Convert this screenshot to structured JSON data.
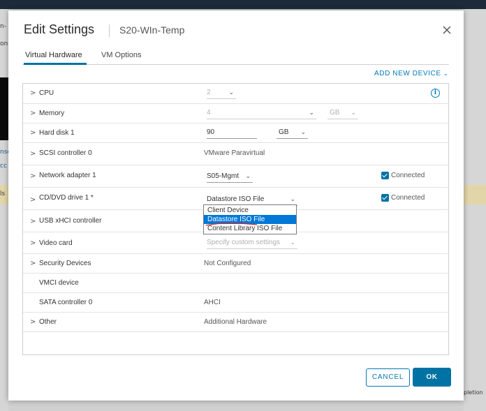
{
  "background": {
    "left_fragments": [
      "n-",
      "on",
      "nse",
      "cc",
      "ls"
    ],
    "right_fragment": "pletion"
  },
  "dialog": {
    "title": "Edit Settings",
    "subtitle": "S20-WIn-Temp",
    "close_icon": "close-icon"
  },
  "tabs": [
    {
      "label": "Virtual Hardware",
      "active": true
    },
    {
      "label": "VM Options",
      "active": false
    }
  ],
  "add_new_device": "ADD NEW DEVICE",
  "hardware": {
    "cpu": {
      "label": "CPU",
      "value": "2"
    },
    "memory": {
      "label": "Memory",
      "value": "4",
      "unit": "GB"
    },
    "hard_disk": {
      "label": "Hard disk 1",
      "value": "90",
      "unit": "GB"
    },
    "scsi": {
      "label": "SCSI controller 0",
      "value": "VMware Paravirtual"
    },
    "network": {
      "label": "Network adapter 1",
      "value": "S05-Mgmt",
      "connected_label": "Connected",
      "connected": true
    },
    "cdrom": {
      "label": "CD/DVD drive 1 *",
      "value": "Datastore ISO File",
      "connected_label": "Connected",
      "connected": true
    },
    "usb": {
      "label": "USB xHCI controller"
    },
    "video": {
      "label": "Video card",
      "value": "Specify custom settings"
    },
    "security": {
      "label": "Security Devices",
      "value": "Not Configured"
    },
    "vmci": {
      "label": "VMCI device"
    },
    "sata": {
      "label": "SATA controller 0",
      "value": "AHCI"
    },
    "other": {
      "label": "Other",
      "value": "Additional Hardware"
    }
  },
  "cdrom_dropdown": {
    "options": [
      "Client Device",
      "Datastore ISO File",
      "Content Library ISO File"
    ],
    "selected": "Datastore ISO File"
  },
  "footer": {
    "cancel_label": "CANCEL",
    "ok_label": "OK"
  },
  "colors": {
    "accent": "#0072a3",
    "link": "#0079b8",
    "dropdown_highlight": "#0078d7"
  }
}
